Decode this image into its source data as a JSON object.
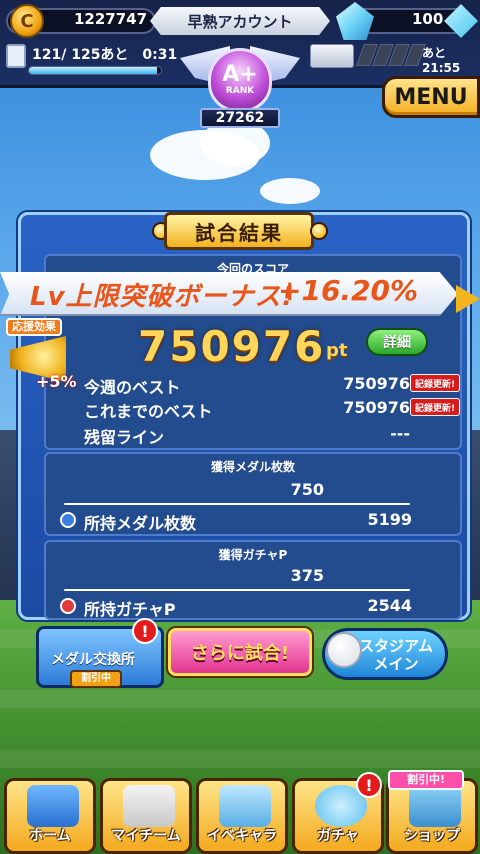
{
  "topbar": {
    "coins": "1227747",
    "account_name": "早熟アカウント",
    "gems": "100",
    "stamina_text": "121/ 125あと　0:31",
    "stamina_fraction": 0.968,
    "ticket_time": "あと21:55"
  },
  "rank": {
    "letter": "A+",
    "word": "RANK",
    "points": "27262"
  },
  "menu_label": "MENU",
  "result": {
    "title": "試合結果",
    "score_section_label": "今回のスコア",
    "bonus_text": "Lv上限突破ボーナス!",
    "bonus_value": "+16.20%",
    "support_title": "応援効果",
    "support_pct": "+5%",
    "score": "750976",
    "score_unit": "pt",
    "detail_label": "詳細",
    "weekly_best_label": "今週のベスト",
    "weekly_best_value": "750976",
    "all_time_best_label": "これまでのベスト",
    "all_time_best_value": "750976",
    "new_record_label": "記録更新!",
    "remaining_line_label": "残留ライン",
    "remaining_line_value": "---",
    "medals_label": "獲得メダル枚数",
    "medals_value": "750",
    "medals_owned_label": "所持メダル枚数",
    "medals_owned_value": "5199",
    "gacha_label": "獲得ガチャP",
    "gacha_value": "375",
    "gacha_owned_label": "所持ガチャP",
    "gacha_owned_value": "2544"
  },
  "actions": {
    "exchange_label": "メダル交換所",
    "discount_label": "割引中",
    "play_again_label": "さらに試合!",
    "stadium_label_1": "スタジアム",
    "stadium_label_2": "メイン",
    "alert": "!"
  },
  "nav": {
    "home": "ホーム",
    "my_team": "マイチーム",
    "event_chara": "イベキャラ",
    "gacha": "ガチャ",
    "shop": "ショップ",
    "shop_sale": "割引中!"
  },
  "colors": {
    "accent_gold": "#f3ae22",
    "panel_blue": "#1b4aa3",
    "bonus_orange": "#e8561c",
    "alert_red": "#e41b1b"
  }
}
